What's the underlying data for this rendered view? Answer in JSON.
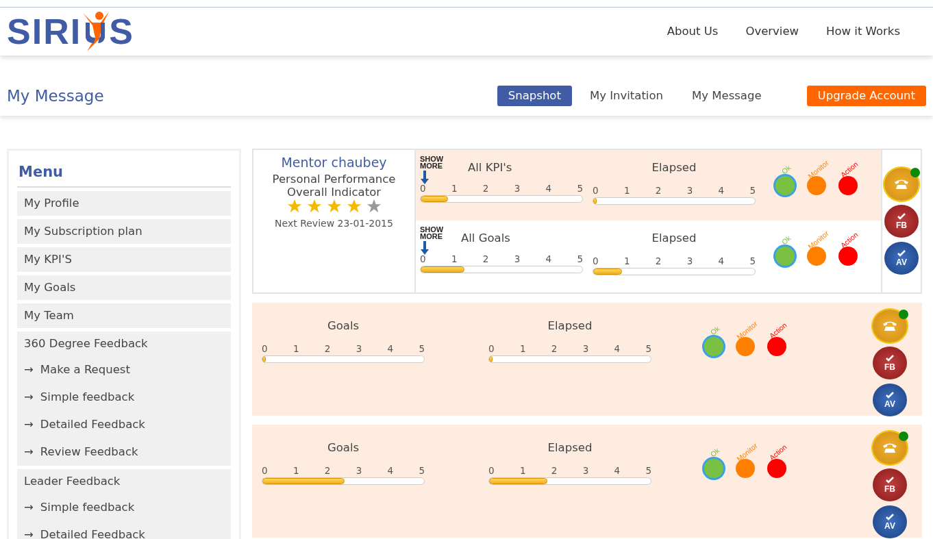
{
  "logo": {
    "left": "SIRI",
    "right": "S"
  },
  "nav": [
    "About Us",
    "Overview",
    "How it Works"
  ],
  "page_title": "My Message",
  "tabs": [
    {
      "label": "Snapshot",
      "selected": true
    },
    {
      "label": "My Invitation",
      "selected": false
    },
    {
      "label": "My Message",
      "selected": false
    }
  ],
  "upgrade_button": "Upgrade Account",
  "sidebar": {
    "title": "Menu",
    "items": [
      {
        "label": "My Profile"
      },
      {
        "label": "My Subscription plan"
      },
      {
        "label": "My KPI'S"
      },
      {
        "label": "My Goals"
      },
      {
        "label": "My Team"
      },
      {
        "label": "360 Degree Feedback",
        "children": [
          {
            "arrow": "→",
            "label": "Make a Request"
          },
          {
            "arrow": "→",
            "label": "Simple feedback"
          },
          {
            "arrow": "→",
            "label": "Detailed Feedback"
          },
          {
            "arrow": "→",
            "label": "Review Feedback"
          }
        ]
      },
      {
        "label": "Leader Feedback",
        "children": [
          {
            "arrow": "→",
            "label": "Simple feedback"
          },
          {
            "arrow": "→",
            "label": "Detailed Feedback"
          }
        ]
      }
    ]
  },
  "summary_card": {
    "name": "Mentor chaubey",
    "subtitle": [
      "Personal Performance",
      "Overall Indicator"
    ],
    "stars": 4,
    "next_review": "Next Review 23-01-2015",
    "rows": [
      {
        "highlighted": true,
        "show_more": [
          "SHOW",
          "MORE"
        ],
        "score": {
          "label": "All KPI's",
          "ticks": [
            "0",
            "1",
            "2",
            "3",
            "4",
            "5"
          ],
          "level": 0.17
        },
        "elapsed": {
          "label": "Elapsed",
          "ticks": [
            "0",
            "1",
            "2",
            "3",
            "4",
            "5"
          ],
          "level": 0.01
        },
        "lights": [
          {
            "label": "Ok",
            "color": "#7ac143",
            "selected": true
          },
          {
            "label": "Monitor",
            "color": "#ff8000",
            "selected": false
          },
          {
            "label": "Action",
            "color": "#ff0000",
            "selected": false
          }
        ]
      },
      {
        "highlighted": false,
        "show_more": [
          "SHOW",
          "MORE"
        ],
        "score": {
          "label": "All Goals",
          "ticks": [
            "0",
            "1",
            "2",
            "3",
            "4",
            "5"
          ],
          "level": 0.27
        },
        "elapsed": {
          "label": "Elapsed",
          "ticks": [
            "0",
            "1",
            "2",
            "3",
            "4",
            "5"
          ],
          "level": 0.18
        },
        "lights": [
          {
            "label": "Ok",
            "color": "#7ac143",
            "selected": true
          },
          {
            "label": "Monitor",
            "color": "#ff8000",
            "selected": false
          },
          {
            "label": "Action",
            "color": "#ff0000",
            "selected": false
          }
        ]
      }
    ],
    "actions": [
      {
        "kind": "phone",
        "online": true
      },
      {
        "kind": "check",
        "label": "FB"
      },
      {
        "kind": "check",
        "label": "AV"
      }
    ]
  },
  "goal_cards": [
    {
      "score": {
        "label": "Goals",
        "ticks": [
          "0",
          "1",
          "2",
          "3",
          "4",
          "5"
        ],
        "level": 0.02
      },
      "elapsed": {
        "label": "Elapsed",
        "ticks": [
          "0",
          "1",
          "2",
          "3",
          "4",
          "5"
        ],
        "level": 0.02
      },
      "lights": [
        {
          "label": "Ok",
          "color": "#7ac143",
          "selected": true
        },
        {
          "label": "Monitor",
          "color": "#ff8000",
          "selected": false
        },
        {
          "label": "Action",
          "color": "#ff0000",
          "selected": false
        }
      ],
      "actions": [
        {
          "kind": "phone",
          "online": true
        },
        {
          "kind": "check",
          "label": "FB"
        },
        {
          "kind": "check",
          "label": "AV"
        }
      ]
    },
    {
      "score": {
        "label": "Goals",
        "ticks": [
          "0",
          "1",
          "2",
          "3",
          "4",
          "5"
        ],
        "level": 0.51
      },
      "elapsed": {
        "label": "Elapsed",
        "ticks": [
          "0",
          "1",
          "2",
          "3",
          "4",
          "5"
        ],
        "level": 0.36
      },
      "lights": [
        {
          "label": "Ok",
          "color": "#7ac143",
          "selected": true
        },
        {
          "label": "Monitor",
          "color": "#ff8000",
          "selected": false
        },
        {
          "label": "Action",
          "color": "#ff0000",
          "selected": false
        }
      ],
      "actions": [
        {
          "kind": "phone",
          "online": true
        },
        {
          "kind": "check",
          "label": "FB"
        },
        {
          "kind": "check",
          "label": "AV"
        }
      ]
    }
  ]
}
